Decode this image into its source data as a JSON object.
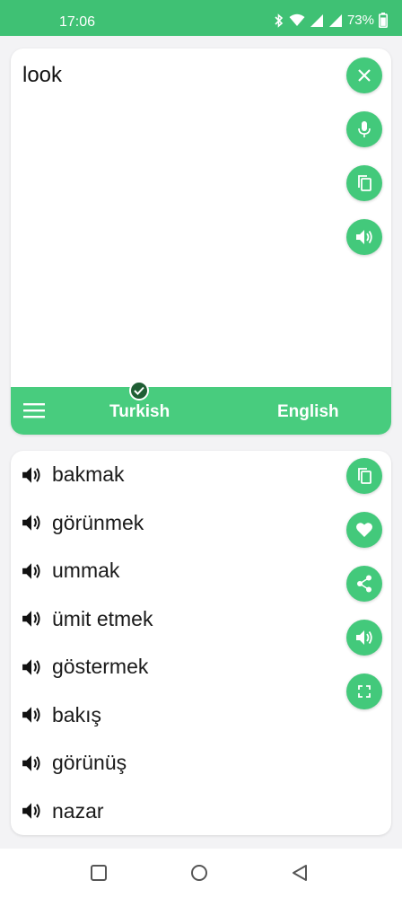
{
  "status_bar": {
    "time": "17:06",
    "battery": "73%",
    "icons": [
      "bluetooth-icon",
      "wifi-icon",
      "signal-icon",
      "signal-icon",
      "battery-icon"
    ]
  },
  "input": {
    "text": "look",
    "actions": [
      "close-icon",
      "mic-icon",
      "copy-icon",
      "speaker-icon"
    ]
  },
  "language_bar": {
    "source": "Turkish",
    "target": "English",
    "source_selected": true
  },
  "results": {
    "words": [
      "bakmak",
      "görünmek",
      "ummak",
      "ümit etmek",
      "göstermek",
      "bakış",
      "görünüş",
      "nazar"
    ],
    "actions": [
      "copy-icon",
      "heart-icon",
      "share-icon",
      "speaker-icon",
      "fullscreen-icon"
    ]
  },
  "nav_bar": {
    "buttons": [
      "recents-icon",
      "home-icon",
      "back-icon"
    ]
  },
  "colors": {
    "accent": "#43c97b",
    "status_bar": "#3fc174",
    "check": "#1f5e34"
  }
}
